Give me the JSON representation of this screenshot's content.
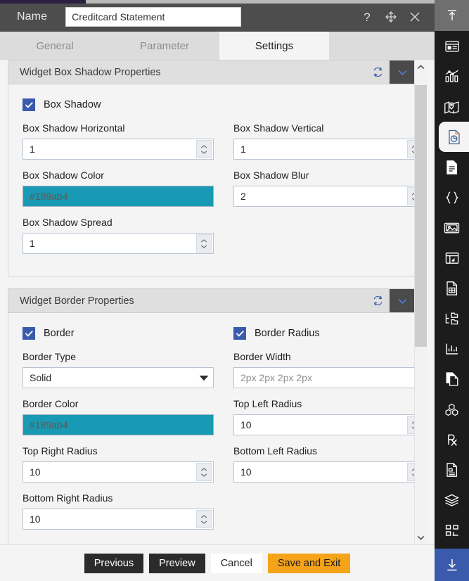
{
  "window": {
    "name_label": "Name",
    "name_value": "Creditcard Statement",
    "controls": [
      {
        "icon": "help-icon",
        "label": "?"
      },
      {
        "icon": "move-icon",
        "label": "Move"
      },
      {
        "icon": "close-icon",
        "label": "Close"
      }
    ]
  },
  "tabs": [
    {
      "label": "General",
      "active": false
    },
    {
      "label": "Parameter",
      "active": false
    },
    {
      "label": "Settings",
      "active": true
    }
  ],
  "sections": [
    {
      "title": "Widget Box Shadow Properties",
      "refresh_icon": "refresh-icon",
      "collapse_icon": "chevron-down-icon",
      "checkboxes": [
        {
          "label": "Box Shadow",
          "checked": true
        }
      ],
      "fields": [
        {
          "label": "Box Shadow Horizontal",
          "value": "1",
          "type": "spinner"
        },
        {
          "label": "Box Shadow Vertical",
          "value": "1",
          "type": "spinner"
        },
        {
          "label": "Box Shadow Color",
          "value": "#189ab4",
          "type": "color",
          "swatch": "#189ab4"
        },
        {
          "label": "Box Shadow Blur",
          "value": "2",
          "type": "spinner"
        },
        {
          "label": "Box Shadow Spread",
          "value": "1",
          "type": "spinner"
        }
      ]
    },
    {
      "title": "Widget Border Properties",
      "refresh_icon": "refresh-icon",
      "collapse_icon": "chevron-down-icon",
      "checkboxes": [
        {
          "label": "Border",
          "checked": true
        },
        {
          "label": "Border Radius",
          "checked": true
        }
      ],
      "fields": [
        {
          "label": "Border Type",
          "value": "Solid",
          "type": "select"
        },
        {
          "label": "Border Width",
          "value": "2px 2px 2px 2px",
          "type": "text",
          "placeholder": true
        },
        {
          "label": "Border Color",
          "value": "#189ab4",
          "type": "color",
          "swatch": "#189ab4"
        },
        {
          "label": "Top Left Radius",
          "value": "10",
          "type": "spinner"
        },
        {
          "label": "Top Right Radius",
          "value": "10",
          "type": "spinner"
        },
        {
          "label": "Bottom Left Radius",
          "value": "10",
          "type": "spinner"
        },
        {
          "label": "Bottom Right Radius",
          "value": "10",
          "type": "spinner"
        }
      ]
    }
  ],
  "footer": {
    "buttons": [
      {
        "label": "Previous",
        "style": "dark"
      },
      {
        "label": "Preview",
        "style": "dark"
      },
      {
        "label": "Cancel",
        "style": "light"
      },
      {
        "label": "Save and Exit",
        "style": "accent"
      }
    ]
  },
  "rail": {
    "top": {
      "icon": "collapse-up-icon"
    },
    "items": [
      {
        "icon": "window-panel-icon",
        "selected": false
      },
      {
        "icon": "bar-chart-icon",
        "selected": false
      },
      {
        "icon": "map-pin-icon",
        "selected": false
      },
      {
        "icon": "pie-document-icon",
        "selected": true
      },
      {
        "icon": "document-icon",
        "selected": false
      },
      {
        "icon": "curly-braces-icon",
        "selected": false
      },
      {
        "icon": "image-icon",
        "selected": false
      },
      {
        "icon": "table-insert-icon",
        "selected": false
      },
      {
        "icon": "document-grid-icon",
        "selected": false
      },
      {
        "icon": "hierarchy-icon",
        "selected": false
      },
      {
        "icon": "chart-line-icon",
        "selected": false
      },
      {
        "icon": "copy-document-icon",
        "selected": false
      },
      {
        "icon": "cubes-icon",
        "selected": false
      },
      {
        "icon": "rx-icon",
        "selected": false
      },
      {
        "icon": "document-list-icon",
        "selected": false
      },
      {
        "icon": "layers-icon",
        "selected": false
      },
      {
        "icon": "layout-blocks-icon",
        "selected": false
      }
    ],
    "download": {
      "icon": "download-icon"
    }
  },
  "colors": {
    "accent_orange": "#f5a318",
    "checkbox_blue": "#3a5bab",
    "swatch_teal": "#189ab4",
    "titlebar": "#4d4d4d",
    "rail_bg": "#1c1c1c"
  },
  "scrollbar": {
    "up_icon": "chevron-up-icon",
    "down_icon": "chevron-down-icon"
  }
}
